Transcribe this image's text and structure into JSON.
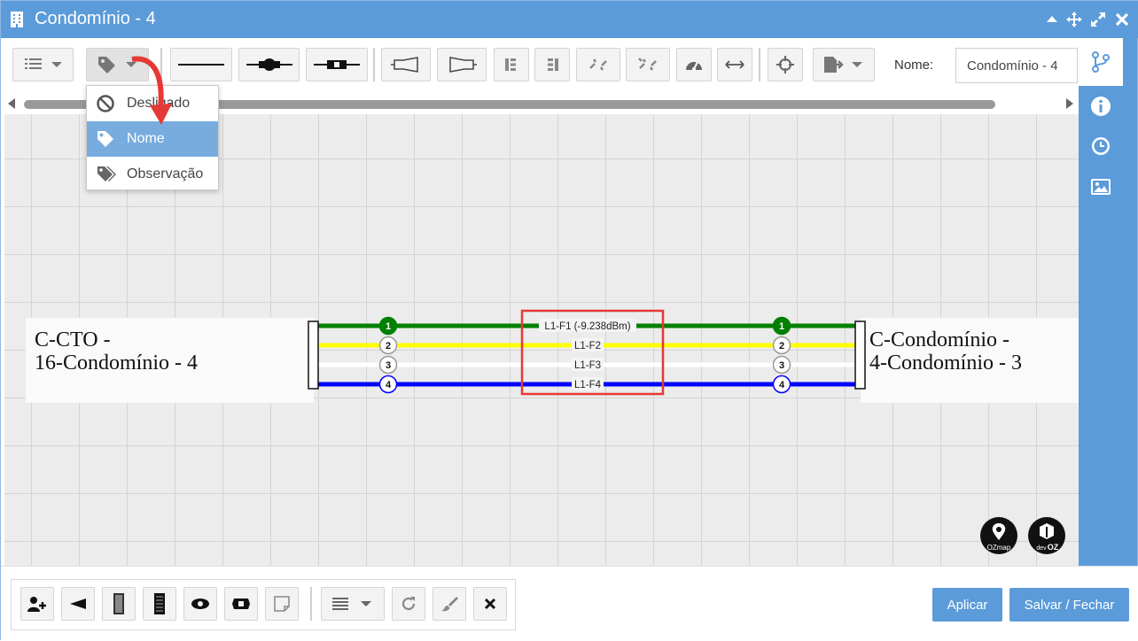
{
  "window": {
    "title": "Condomínio - 4"
  },
  "toolbar": {
    "name_label": "Nome:",
    "name_value": "Condomínio - 4"
  },
  "dropdown": {
    "items": [
      {
        "label": "Desligado",
        "icon": "ban-icon"
      },
      {
        "label": "Nome",
        "icon": "tag-icon",
        "selected": true
      },
      {
        "label": "Observação",
        "icon": "tags-icon"
      }
    ]
  },
  "diagram": {
    "left_box": {
      "line1": "C-CTO -",
      "line2": "16-Condomínio - 4"
    },
    "right_box": {
      "line1": "C-Condomínio -",
      "line2": "4-Condomínio - 3"
    },
    "fibers": [
      {
        "number": "1",
        "label": "L1-F1 (-9.238dBm)",
        "color": "#008000"
      },
      {
        "number": "2",
        "label": "L1-F2",
        "color": "#ffff00"
      },
      {
        "number": "3",
        "label": "L1-F3",
        "color": "#ffffff"
      },
      {
        "number": "4",
        "label": "L1-F4",
        "color": "#0000ff"
      }
    ],
    "highlight_color": "#e53935"
  },
  "logos": {
    "ozmap": "OZmap",
    "devoz_top": "dev",
    "devoz_bottom": "OZ"
  },
  "footer": {
    "apply_label": "Aplicar",
    "save_close_label": "Salvar / Fechar"
  },
  "colors": {
    "accent": "#5b9bd9",
    "selected": "#78acdf",
    "arrow": "#e53935"
  }
}
